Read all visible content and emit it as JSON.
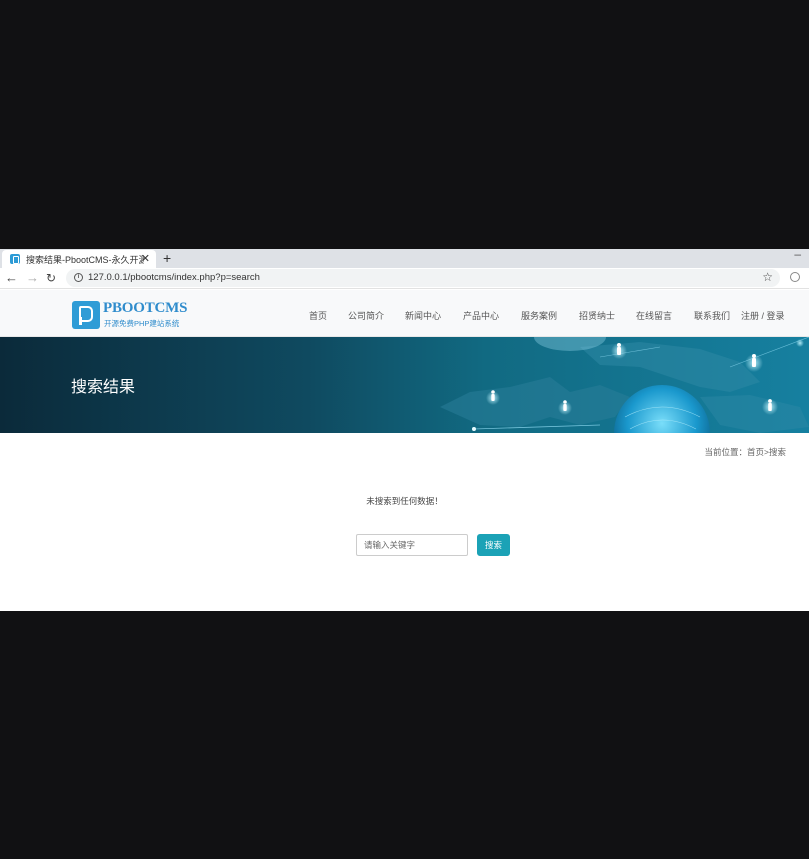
{
  "browser": {
    "tab_title": "搜索结果-PbootCMS-永久开源免费",
    "tab_close": "✕",
    "new_tab": "+",
    "minimize": "–",
    "url": "127.0.0.1/pbootcms/index.php?p=search",
    "icons": [
      "back-arrow-icon",
      "forward-arrow-icon",
      "reload-icon",
      "info-icon",
      "star-icon",
      "account-icon"
    ]
  },
  "site": {
    "logo_name": "PBOOTCMS",
    "logo_tagline": "开源免费PHP建站系统",
    "nav": [
      "首页",
      "公司简介",
      "新闻中心",
      "产品中心",
      "服务案例",
      "招贤纳士",
      "在线留言",
      "联系我们"
    ],
    "auth_register": "注册",
    "auth_separator": " / ",
    "auth_login": "登录"
  },
  "banner": {
    "title": "搜索结果"
  },
  "breadcrumb": {
    "prefix": "当前位置：",
    "home": "首页",
    "separator": ">",
    "current": "搜索"
  },
  "content": {
    "no_result": "未搜索到任何数据！",
    "search_placeholder": "请输入关键字",
    "search_button": "搜索"
  },
  "colors": {
    "accent": "#1ba2b6",
    "brand": "#2f8ccc",
    "banner_dark": "#0b2a3a",
    "letterbox": "#111113"
  }
}
